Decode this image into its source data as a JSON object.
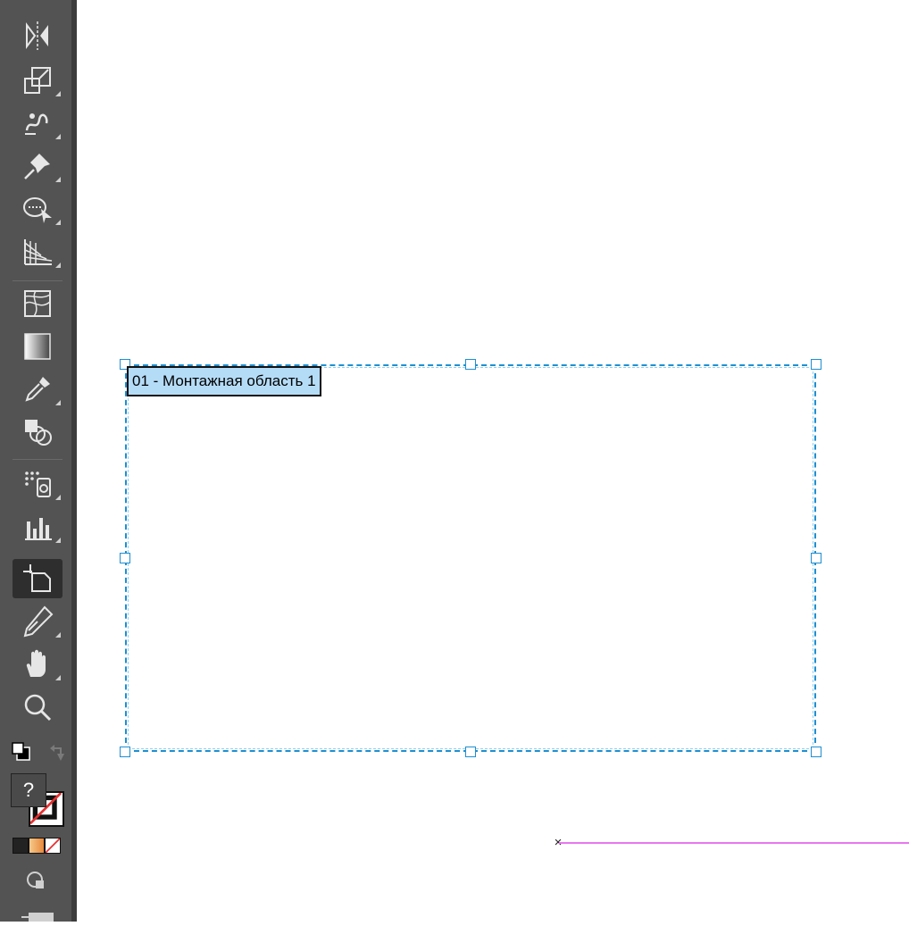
{
  "toolbar": {
    "tools": [
      {
        "name": "reflect-tool",
        "icon": "reflect-icon"
      },
      {
        "name": "scale-tool",
        "icon": "scale-icon"
      },
      {
        "name": "warp-tool",
        "icon": "warp-icon"
      },
      {
        "name": "puppet-warp-tool",
        "icon": "pin-icon"
      },
      {
        "name": "free-transform-tool",
        "icon": "free-transform-icon"
      },
      {
        "name": "perspective-grid-tool",
        "icon": "perspective-grid-icon"
      },
      {
        "name": "mesh-tool",
        "icon": "mesh-icon"
      },
      {
        "name": "gradient-tool",
        "icon": "gradient-icon"
      },
      {
        "name": "eyedropper-tool",
        "icon": "eyedropper-icon"
      },
      {
        "name": "blend-tool",
        "icon": "blend-icon"
      },
      {
        "name": "symbol-sprayer-tool",
        "icon": "symbol-sprayer-icon"
      },
      {
        "name": "column-graph-tool",
        "icon": "column-graph-icon"
      },
      {
        "name": "artboard-tool",
        "icon": "artboard-icon",
        "active": true
      },
      {
        "name": "slice-tool",
        "icon": "slice-icon"
      },
      {
        "name": "hand-tool",
        "icon": "hand-icon"
      },
      {
        "name": "zoom-tool",
        "icon": "zoom-icon"
      }
    ],
    "fill_stroke": {
      "fill_label": "?"
    },
    "colors": {
      "panel": "#535353",
      "active": "#2e2e2e",
      "accent": "#1e8fd0",
      "guide": "#e777ee"
    }
  },
  "artboard": {
    "label": "01 - Монтажная область 1"
  },
  "guide": {
    "marker": "×"
  }
}
